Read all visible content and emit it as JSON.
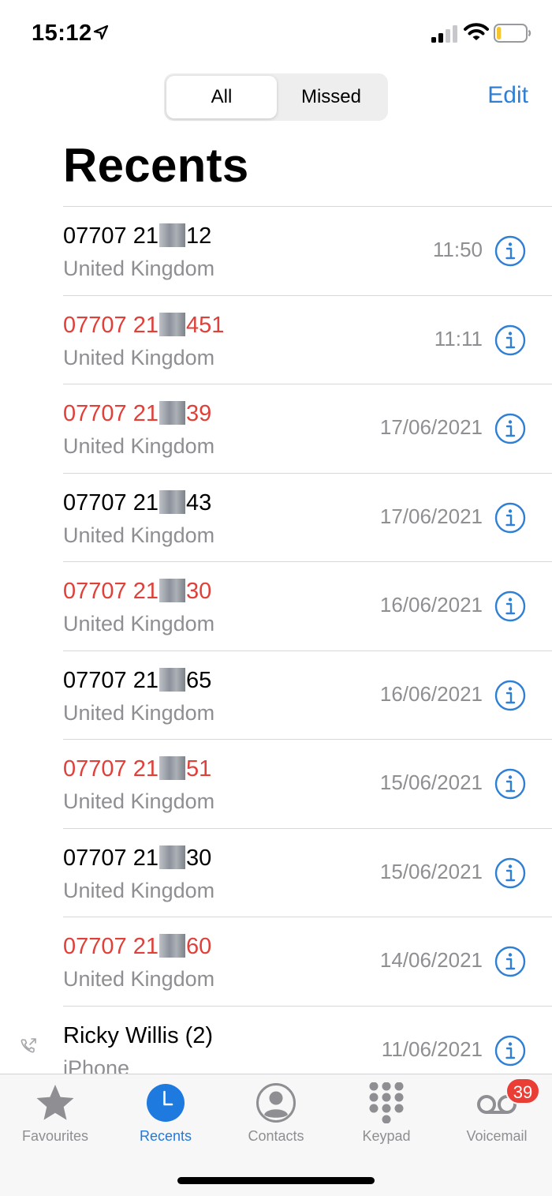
{
  "status_bar": {
    "time": "15:12",
    "location_icon": "location-arrow-icon",
    "signal_icon": "cellular-signal-icon",
    "wifi_icon": "wifi-icon",
    "battery_icon": "battery-low-icon",
    "battery_level": 0.15
  },
  "header": {
    "segments": [
      {
        "label": "All",
        "selected": true
      },
      {
        "label": "Missed",
        "selected": false
      }
    ],
    "edit_label": "Edit",
    "title": "Recents"
  },
  "colors": {
    "accent": "#2f7fd5",
    "missed": "#e0403a",
    "secondary_text": "#8e8e93",
    "badge": "#ea3d36"
  },
  "calls": [
    {
      "name_prefix": "07707 21",
      "name_suffix": "12",
      "redacted": true,
      "missed": false,
      "subtitle": "United Kingdom",
      "time": "11:50"
    },
    {
      "name_prefix": "07707 21",
      "name_suffix": "451",
      "redacted": true,
      "missed": true,
      "subtitle": "United Kingdom",
      "time": "11:11"
    },
    {
      "name_prefix": "07707 21",
      "name_suffix": "39",
      "redacted": true,
      "missed": true,
      "subtitle": "United Kingdom",
      "time": "17/06/2021"
    },
    {
      "name_prefix": "07707 21",
      "name_suffix": "43",
      "redacted": true,
      "missed": false,
      "subtitle": "United Kingdom",
      "time": "17/06/2021"
    },
    {
      "name_prefix": "07707 21",
      "name_suffix": "30",
      "redacted": true,
      "missed": true,
      "subtitle": "United Kingdom",
      "time": "16/06/2021"
    },
    {
      "name_prefix": "07707 21",
      "name_suffix": "65",
      "redacted": true,
      "missed": false,
      "subtitle": "United Kingdom",
      "time": "16/06/2021"
    },
    {
      "name_prefix": "07707 21",
      "name_suffix": "51",
      "redacted": true,
      "missed": true,
      "subtitle": "United Kingdom",
      "time": "15/06/2021"
    },
    {
      "name_prefix": "07707 21",
      "name_suffix": "30",
      "redacted": true,
      "missed": false,
      "subtitle": "United Kingdom",
      "time": "15/06/2021"
    },
    {
      "name_prefix": "07707 21",
      "name_suffix": "60",
      "redacted": true,
      "missed": true,
      "subtitle": "United Kingdom",
      "time": "14/06/2021"
    },
    {
      "name_prefix": "Ricky Willis (2)",
      "name_suffix": "",
      "redacted": false,
      "missed": false,
      "outgoing": true,
      "subtitle": "iPhone",
      "time": "11/06/2021"
    }
  ],
  "tab_bar": {
    "tabs": [
      {
        "label": "Favourites",
        "icon": "star-icon",
        "active": false
      },
      {
        "label": "Recents",
        "icon": "clock-icon",
        "active": true
      },
      {
        "label": "Contacts",
        "icon": "person-circle-icon",
        "active": false
      },
      {
        "label": "Keypad",
        "icon": "keypad-icon",
        "active": false
      },
      {
        "label": "Voicemail",
        "icon": "voicemail-icon",
        "active": false,
        "badge": "39"
      }
    ]
  }
}
